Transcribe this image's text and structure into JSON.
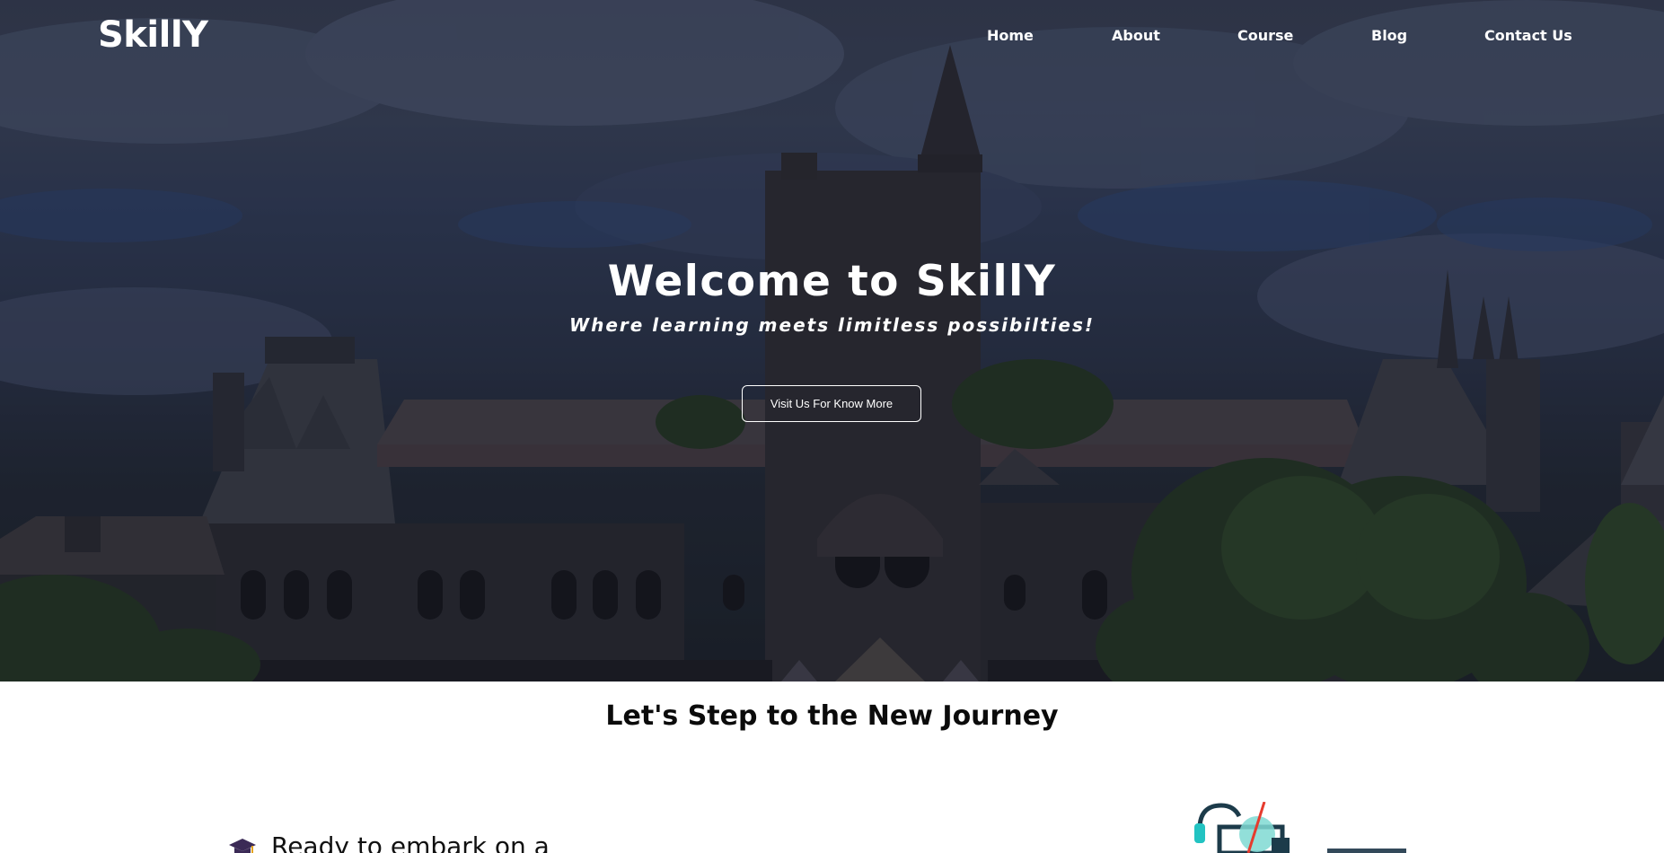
{
  "brand": {
    "logo": "SkillY"
  },
  "nav": {
    "items": [
      {
        "label": "Home"
      },
      {
        "label": "About"
      },
      {
        "label": "Course"
      },
      {
        "label": "Blog"
      },
      {
        "label": "Contact Us"
      }
    ]
  },
  "hero": {
    "title": "Welcome to SkillY",
    "subtitle": "Where learning meets limitless possibilties!",
    "cta_label": "Visit Us For Know More"
  },
  "journey": {
    "heading": "Let's Step to the New Journey",
    "intro_text": "Ready to embark on a"
  },
  "icons": [
    "graduation-cap-icon"
  ]
}
